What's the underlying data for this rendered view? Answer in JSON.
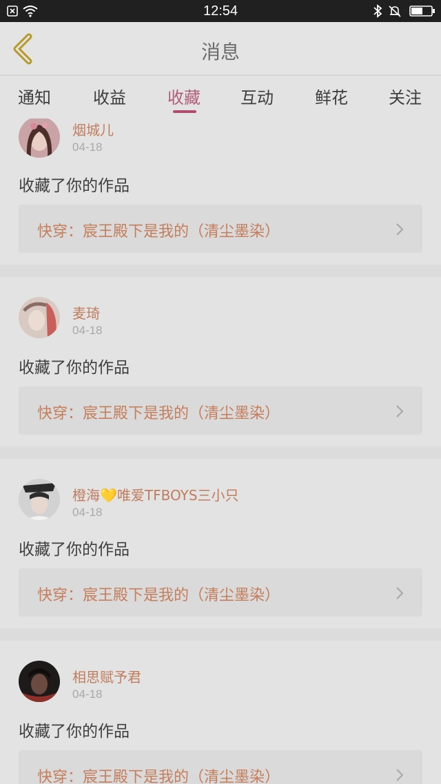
{
  "status_bar": {
    "time": "12:54",
    "icons": [
      "close-box-icon",
      "wifi-icon",
      "bluetooth-icon",
      "bell-muted-icon",
      "battery-icon"
    ]
  },
  "header": {
    "back_icon": "chevron-left-icon",
    "title": "消息"
  },
  "tabs": [
    {
      "label": "通知",
      "active": false
    },
    {
      "label": "收益",
      "active": false
    },
    {
      "label": "收藏",
      "active": true
    },
    {
      "label": "互动",
      "active": false
    },
    {
      "label": "鲜花",
      "active": false
    },
    {
      "label": "关注",
      "active": false
    }
  ],
  "messages": [
    {
      "user": "烟城儿",
      "date": "04-18",
      "action": "收藏了你的作品",
      "work": "快穿：宸王殿下是我的（清尘墨染）"
    },
    {
      "user": "麦琦",
      "date": "04-18",
      "action": "收藏了你的作品",
      "work": "快穿：宸王殿下是我的（清尘墨染）"
    },
    {
      "user": "橙海💛唯爱TFBOYS三小只",
      "date": "04-18",
      "action": "收藏了你的作品",
      "work": "快穿：宸王殿下是我的（清尘墨染）"
    },
    {
      "user": "相思赋予君",
      "date": "04-18",
      "action": "收藏了你的作品",
      "work": "快穿：宸王殿下是我的（清尘墨染）"
    }
  ],
  "colors": {
    "accent": "#b34a70",
    "username": "#c07d5d",
    "work_title": "#c57e5c",
    "back_icon": "#b89a2a"
  }
}
